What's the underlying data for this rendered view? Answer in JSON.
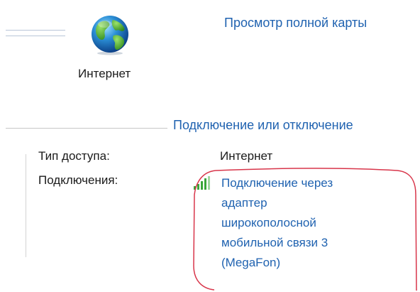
{
  "header": {
    "view_full_map_link": "Просмотр полной карты"
  },
  "network_map": {
    "internet_node_label": "Интернет",
    "internet_icon": "globe-icon"
  },
  "connect_disconnect_link": "Подключение или отключение",
  "details": {
    "access_type_label": "Тип доступа:",
    "access_type_value": "Интернет",
    "connections_label": "Подключения:",
    "connection_icon": "signal-strength-icon",
    "connection_lines": [
      "Подключение через",
      "адаптер",
      "широкополосной",
      "мобильной связи 3",
      "(MegaFon)"
    ]
  },
  "colors": {
    "link": "#1f62b0",
    "highlight": "#d8354a",
    "signal": "#3aa63a"
  }
}
